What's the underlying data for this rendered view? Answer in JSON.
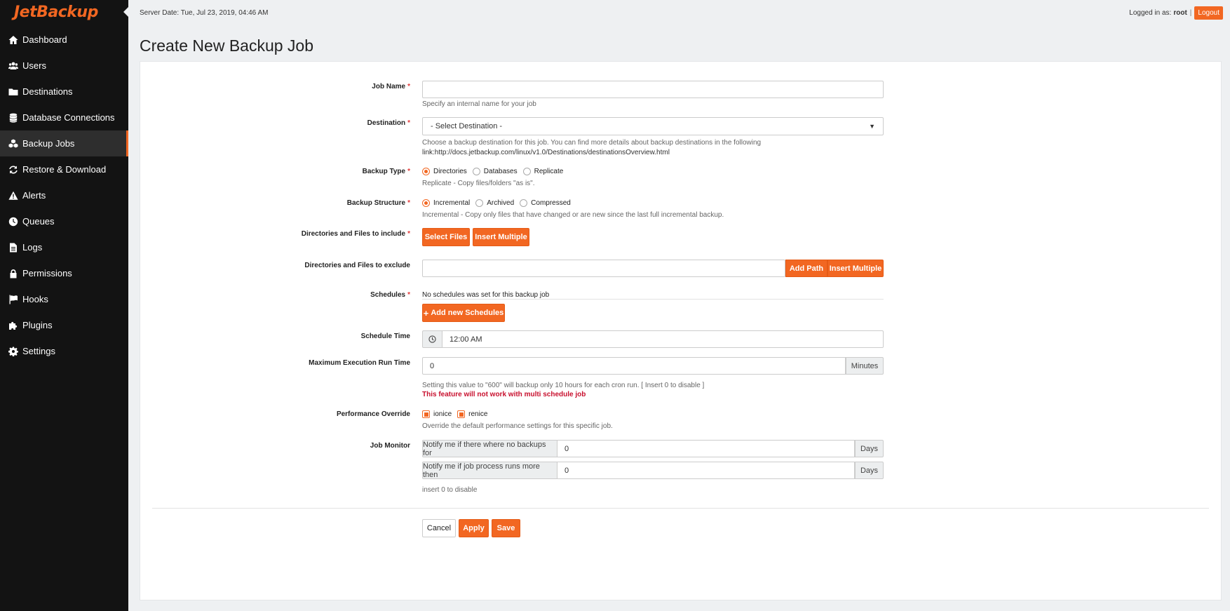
{
  "app": {
    "logo_text": "JetBackup",
    "brand_color": "#f26722"
  },
  "sidebar": {
    "items": [
      {
        "label": "Dashboard",
        "icon": "home-icon",
        "active": false
      },
      {
        "label": "Users",
        "icon": "users-icon",
        "active": false
      },
      {
        "label": "Destinations",
        "icon": "folder-icon",
        "active": false
      },
      {
        "label": "Database Connections",
        "icon": "database-icon",
        "active": false
      },
      {
        "label": "Backup Jobs",
        "icon": "cubes-icon",
        "active": true
      },
      {
        "label": "Restore & Download",
        "icon": "refresh-icon",
        "active": false
      },
      {
        "label": "Alerts",
        "icon": "warning-icon",
        "active": false
      },
      {
        "label": "Queues",
        "icon": "clock-icon",
        "active": false
      },
      {
        "label": "Logs",
        "icon": "file-icon",
        "active": false
      },
      {
        "label": "Permissions",
        "icon": "lock-icon",
        "active": false
      },
      {
        "label": "Hooks",
        "icon": "flag-icon",
        "active": false
      },
      {
        "label": "Plugins",
        "icon": "puzzle-icon",
        "active": false
      },
      {
        "label": "Settings",
        "icon": "gear-icon",
        "active": false
      }
    ]
  },
  "topbar": {
    "server_date": "Server Date: Tue, Jul 23, 2019, 04:46 AM",
    "logged_in_label": "Logged in as:",
    "user": "root",
    "separator": "|",
    "logout_label": "Logout"
  },
  "page": {
    "title": "Create New Backup Job"
  },
  "form": {
    "job_name": {
      "label": "Job Name",
      "required": "*",
      "value": "",
      "help": "Specify an internal name for your job"
    },
    "destination": {
      "label": "Destination",
      "required": "*",
      "selected": "- Select Destination -",
      "help_line1": "Choose a backup destination for this job. You can find more details about backup destinations in the following",
      "help_line2": "link:http://docs.jetbackup.com/linux/v1.0/Destinations/destinationsOverview.html"
    },
    "backup_type": {
      "label": "Backup Type",
      "required": "*",
      "options": [
        "Directories",
        "Databases",
        "Replicate"
      ],
      "selected_index": 0,
      "help": "Replicate - Copy files/folders \"as is\"."
    },
    "backup_structure": {
      "label": "Backup Structure",
      "required": "*",
      "options": [
        "Incremental",
        "Archived",
        "Compressed"
      ],
      "selected_index": 0,
      "help": "Incremental - Copy only files that have changed or are new since the last full incremental backup."
    },
    "include": {
      "label": "Directories and Files to include",
      "required": "*",
      "select_files": "Select Files",
      "insert_multiple": "Insert Multiple"
    },
    "exclude": {
      "label": "Directories and Files to exclude",
      "value": "",
      "add_path": "Add Path",
      "insert_multiple": "Insert Multiple"
    },
    "schedules": {
      "label": "Schedules",
      "required": "*",
      "empty_text": "No schedules was set for this backup job",
      "add_button": "Add new Schedules"
    },
    "schedule_time": {
      "label": "Schedule Time",
      "value": "12:00 AM"
    },
    "max_run_time": {
      "label": "Maximum Execution Run Time",
      "value": "0",
      "unit": "Minutes",
      "help": "Setting this value to \"600\" will backup only 10 hours for each cron run. [ Insert 0 to disable ]",
      "warning": "This feature will not work with multi schedule job"
    },
    "performance_override": {
      "label": "Performance Override",
      "options": [
        "ionice",
        "renice"
      ],
      "help": "Override the default performance settings for this specific job."
    },
    "job_monitor": {
      "label": "Job Monitor",
      "rows": [
        {
          "prefix": "Notify me if there where no backups for",
          "value": "0",
          "unit": "Days"
        },
        {
          "prefix": "Notify me if job process runs more then",
          "value": "0",
          "unit": "Days"
        }
      ],
      "help": "insert 0 to disable"
    }
  },
  "actions": {
    "cancel": "Cancel",
    "apply": "Apply",
    "save": "Save"
  }
}
